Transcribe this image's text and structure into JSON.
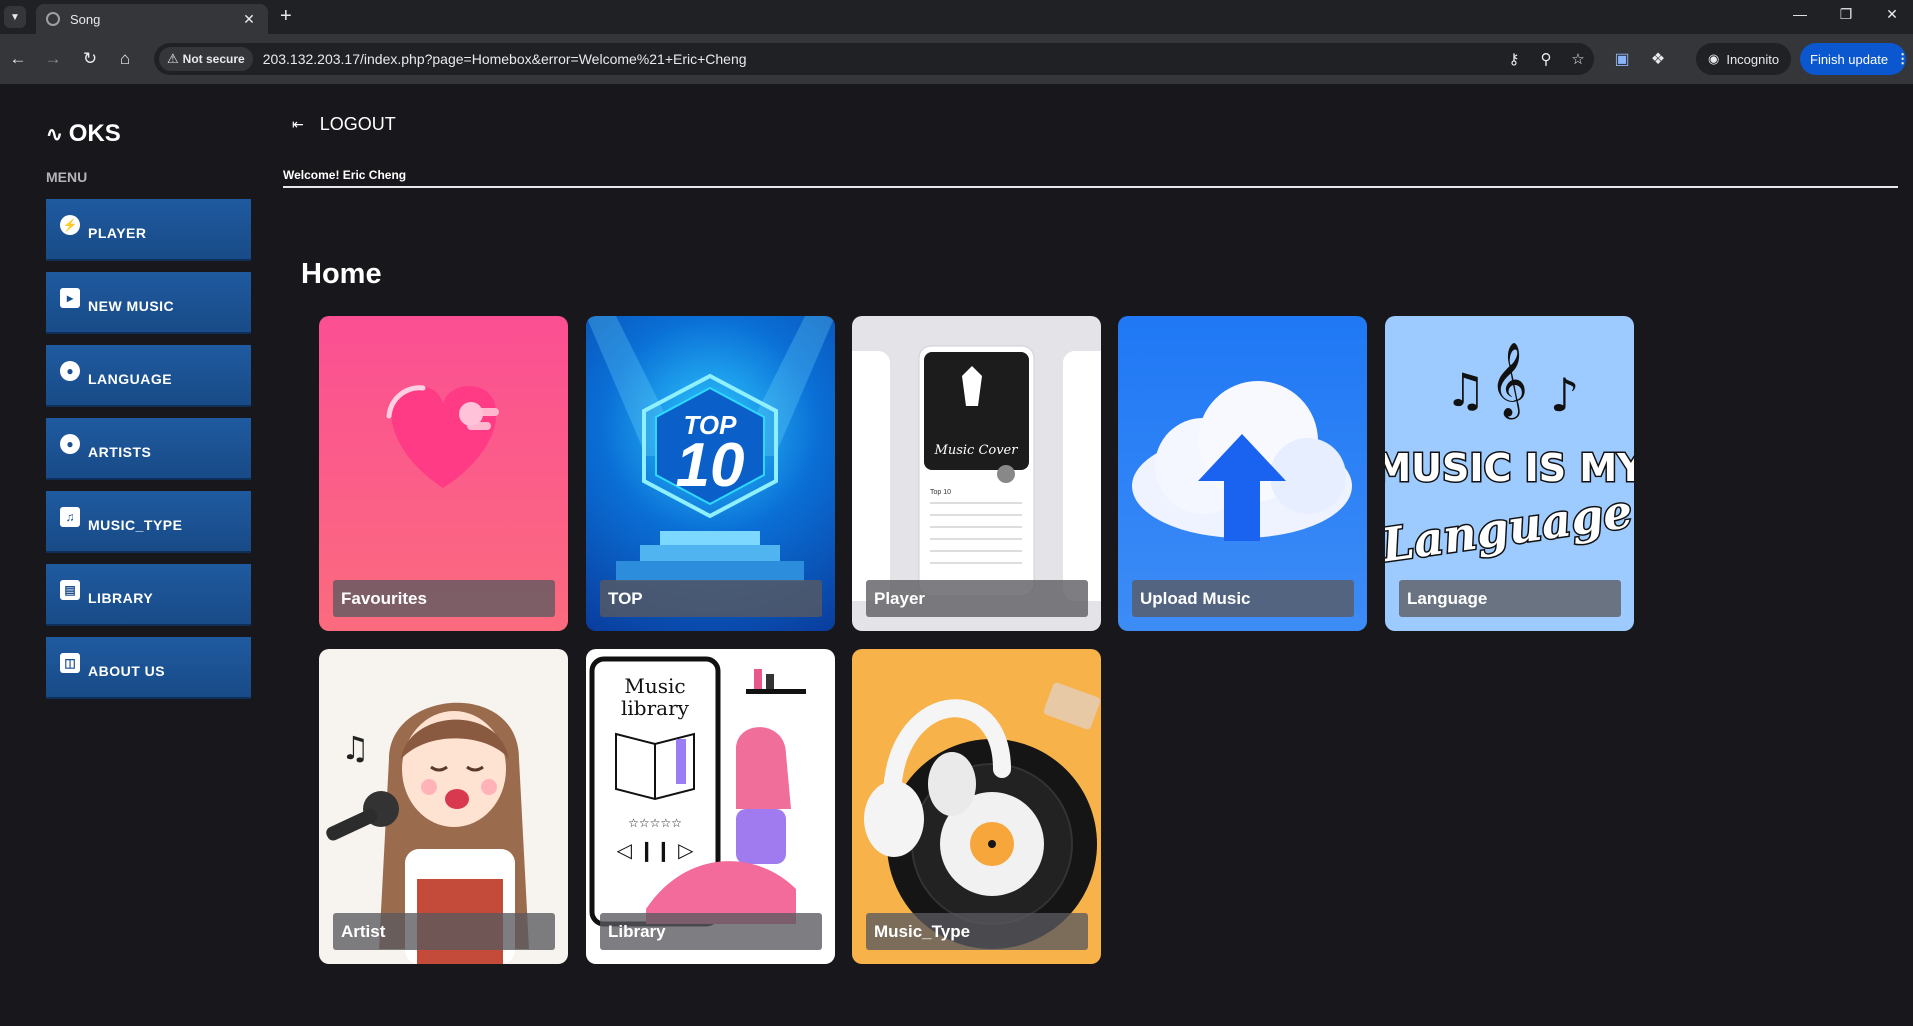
{
  "browser": {
    "tab_title": "Song",
    "security_label": "Not secure",
    "url": "203.132.203.17/index.php?page=Homebox&error=Welcome%21+Eric+Cheng",
    "incognito_label": "Incognito",
    "update_label": "Finish update"
  },
  "sidebar": {
    "logo": "OKS",
    "menu_heading": "MENU",
    "items": [
      {
        "label": "PLAYER",
        "icon": "bolt-icon"
      },
      {
        "label": "NEW MUSIC",
        "icon": "speaker-icon"
      },
      {
        "label": "LANGUAGE",
        "icon": "globe-icon"
      },
      {
        "label": "ARTISTS",
        "icon": "microphone-icon"
      },
      {
        "label": "MUSIC_TYPE",
        "icon": "music-note-icon"
      },
      {
        "label": "LIBRARY",
        "icon": "book-icon"
      },
      {
        "label": "ABOUT US",
        "icon": "radio-icon"
      }
    ]
  },
  "header": {
    "logout_label": "LOGOUT",
    "welcome_text": "Welcome! Eric Cheng"
  },
  "main": {
    "title": "Home",
    "cards": [
      {
        "label": "Favourites",
        "image": "heart"
      },
      {
        "label": "TOP",
        "image": "top-10-podium"
      },
      {
        "label": "Player",
        "image": "phone-screens"
      },
      {
        "label": "Upload Music",
        "image": "cloud-upload"
      },
      {
        "label": "Language",
        "image": "music-is-my-language"
      },
      {
        "label": "Artist",
        "image": "singing-girl"
      },
      {
        "label": "Library",
        "image": "music-library-illustration"
      },
      {
        "label": "Music_Type",
        "image": "headphones-vinyl"
      }
    ],
    "art_text": {
      "top_word": "TOP",
      "top_number": "10",
      "phone_caption": "Music Cover",
      "phone_list_title": "Top 10",
      "lang_line1": "MUSIC IS MY",
      "lang_line2": "Language",
      "library_line1": "Music",
      "library_line2": "library"
    }
  },
  "colors": {
    "sidebar_button": "#1f5aa0",
    "background": "#18181c",
    "update_button": "#0b57d0",
    "favourites_card": "#fb5a8c",
    "upload_card": "#2f7df2",
    "language_card": "#9ecbff",
    "music_type_card": "#f7b24a"
  }
}
